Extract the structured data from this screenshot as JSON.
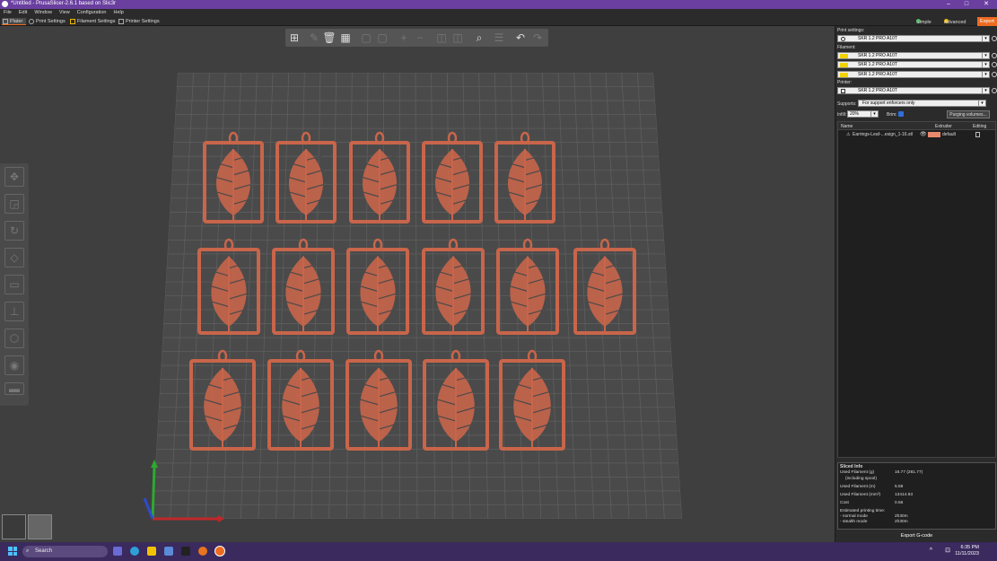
{
  "window": {
    "title": "*Untitled - PrusaSlicer-2.6.1 based on Slic3r",
    "min": "–",
    "max": "□",
    "close": "✕"
  },
  "menu": [
    "File",
    "Edit",
    "Window",
    "View",
    "Configuration",
    "Help"
  ],
  "tabs": {
    "plater": "Plater",
    "print": "Print Settings",
    "filament": "Filament Settings",
    "printer": "Printer Settings"
  },
  "modes": {
    "simple": "Simple",
    "advanced": "Advanced",
    "export": "Export",
    "simple_color": "#2fb34d",
    "advanced_color": "#f0b800"
  },
  "sidebar": {
    "print_settings_label": "Print settings:",
    "print_profile": "SKR 1.2 PRO A10T",
    "filament_label": "Filament:",
    "filaments": [
      {
        "name": "SKR 1.2 PRO A10T",
        "color": "#f2d300"
      },
      {
        "name": "SKR 1.2 PRO A10T",
        "color": "#f2d300"
      },
      {
        "name": "SKR 1.2 PRO A10T",
        "color": "#f2d300"
      }
    ],
    "printer_label": "Printer:",
    "printer_profile": "SKR 1.2 PRO A10T",
    "supports_label": "Supports:",
    "supports_value": "For support enforcers only",
    "infill_label": "Infill:",
    "infill_value": "20%",
    "brim_label": "Brim:",
    "purging_button": "Purging volumes...",
    "obj_headers": {
      "name": "Name",
      "extruder": "Extruder",
      "editing": "Editing"
    },
    "object": {
      "name": "Earrings-Leaf-...esign_1-16.stl",
      "extruder": "default",
      "extruder_color": "#e8896b"
    }
  },
  "sliced_info": {
    "title": "Sliced Info",
    "rows": [
      {
        "k": "Used Filament (g)",
        "v": "16.77 (281.77)"
      },
      {
        "k": "(including spool)",
        "v": ""
      },
      {
        "k": "Used Filament (m)",
        "v": "5.58"
      },
      {
        "k": "Used Filament (mm³)",
        "v": "13414.93"
      },
      {
        "k": "Cost",
        "v": "0.56"
      },
      {
        "k": "Estimated printing time:",
        "v": ""
      },
      {
        "k": " - normal mode",
        "v": "2h30m"
      },
      {
        "k": " - stealth mode",
        "v": "2h30m"
      }
    ],
    "export_button": "Export G-code"
  },
  "taskbar": {
    "search": "Search",
    "time": "6:35 PM",
    "date": "11/11/2023"
  },
  "scene": {
    "part_color": "#c8654a",
    "bed_color": "#4a4a4a",
    "grid_color": "#5e5e5e"
  }
}
